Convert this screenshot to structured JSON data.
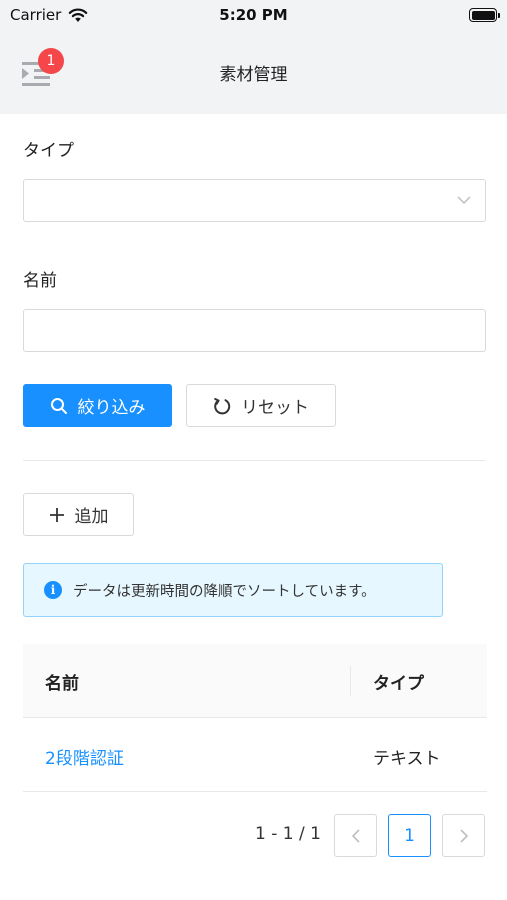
{
  "status_bar": {
    "carrier": "Carrier",
    "time": "5:20 PM"
  },
  "nav": {
    "title": "素材管理",
    "menu_badge_count": "1"
  },
  "filters": {
    "type_label": "タイプ",
    "type_value": "",
    "name_label": "名前",
    "name_value": "",
    "name_placeholder": "",
    "search_button": "絞り込み",
    "reset_button": "リセット"
  },
  "actions": {
    "add_button": "追加"
  },
  "alert": {
    "message": "データは更新時間の降順でソートしています。"
  },
  "table": {
    "columns": [
      "名前",
      "タイプ"
    ],
    "rows": [
      {
        "name": "2段階認証",
        "type": "テキスト"
      }
    ]
  },
  "pagination": {
    "total_text": "1 - 1 / 1",
    "current_page": "1"
  },
  "colors": {
    "primary": "#1890ff",
    "badge": "#f5464a",
    "header_bg": "#f2f3f5",
    "alert_bg": "#e6f7ff"
  },
  "icons": [
    "wifi-icon",
    "battery-icon",
    "menu-icon",
    "chevron-down-icon",
    "search-icon",
    "reload-icon",
    "plus-icon",
    "info-icon",
    "chevron-left-icon",
    "chevron-right-icon"
  ]
}
